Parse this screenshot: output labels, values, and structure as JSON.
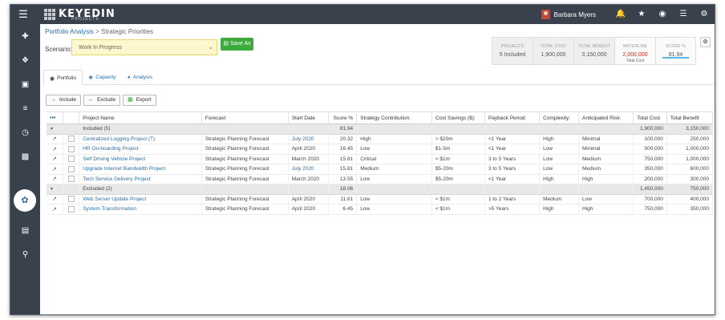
{
  "app": {
    "logo_text": "KEYEDIN",
    "logo_sub": "PROJECTS",
    "user_name": "Barbara Myers"
  },
  "topbar_icons": [
    "menu-icon",
    "bell-icon",
    "star-icon",
    "globe-icon",
    "list-icon",
    "gear-icon"
  ],
  "sidebar_icons": [
    "plus-icon",
    "pin-icon",
    "briefcase-icon",
    "sliders-icon",
    "clock-icon",
    "money-icon",
    "portfolio-icon",
    "dashboard-icon",
    "bar-chart-icon",
    "search-icon"
  ],
  "breadcrumb": {
    "parent": "Portfolio Analysis",
    "separator": " > ",
    "current": "Strategic Priorities"
  },
  "scenario": {
    "label": "Scenario:",
    "value": "Work In Progress",
    "save_label": "Save As"
  },
  "stats": {
    "projects": {
      "title": "PROJECTS",
      "value": "5 Included"
    },
    "total_cost": {
      "title": "TOTAL COST",
      "value": "1,900,000"
    },
    "total_benefit": {
      "title": "TOTAL BENEFIT",
      "value": "3,150,000"
    },
    "waterline": {
      "title": "WATERLINE",
      "value": "2,000,000",
      "sub": "Total Cost",
      "color": "#d0271d"
    },
    "score": {
      "title": "SCORE %",
      "value": "81.94",
      "bar_color": "#5bb5e0"
    }
  },
  "tabs": [
    {
      "label": "Portfolio",
      "icon": "binoculars-icon",
      "active": true
    },
    {
      "label": "Capacity",
      "icon": "pin-icon",
      "active": false
    },
    {
      "label": "Analysis",
      "icon": "dashboard-icon",
      "active": false
    }
  ],
  "actions": {
    "include": "Include",
    "exclude": "Exclude",
    "export": "Export"
  },
  "table": {
    "menu": "•••",
    "headers": [
      "Project Name",
      "Forecast",
      "Start Date",
      "Score %",
      "Strategy Contribution:",
      "Cost Savings ($):",
      "Payback Period:",
      "Complexity:",
      "Anticipated Risk:",
      "Total Cost",
      "Total Benefit"
    ],
    "included": {
      "label": "Included (5)",
      "score": "81.94",
      "total_cost": "1,900,000",
      "total_benefit": "3,150,000",
      "rows": [
        [
          "Centralized Logging Project (T)",
          "Strategic Planning Forecast",
          "July 2020",
          "20.32",
          "High",
          "> $20m",
          "<1 Year",
          "High",
          "Minimal",
          "100,000",
          "250,000"
        ],
        [
          "HR On-boarding Project",
          "Strategic Planning Forecast",
          "April 2020",
          "16.45",
          "Low",
          "$1-5m",
          "<1 Year",
          "Low",
          "Minimal",
          "500,000",
          "1,000,000"
        ],
        [
          "Self Driving Vehicle Project",
          "Strategic Planning Forecast",
          "March 2020",
          "15.81",
          "Critical",
          "< $1m",
          "3 to 5 Years",
          "Low",
          "Medium",
          "750,000",
          "1,000,000"
        ],
        [
          "Upgrade Internet Bandwidth Project",
          "Strategic Planning Forecast",
          "July 2020",
          "15.81",
          "Medium",
          "$5-20m",
          "3 to 5 Years",
          "Low",
          "Medium",
          "350,000",
          "600,000"
        ],
        [
          "Tech Service Delivery Project",
          "Strategic Planning Forecast",
          "March 2020",
          "13.55",
          "Low",
          "$5-20m",
          "<1 Year",
          "High",
          "High",
          "200,000",
          "300,000"
        ]
      ]
    },
    "excluded": {
      "label": "Excluded (2)",
      "score": "18.06",
      "total_cost": "1,450,000",
      "total_benefit": "750,000",
      "rows": [
        [
          "Web Server Update Project",
          "Strategic Planning Forecast",
          "April 2020",
          "11.61",
          "Low",
          "< $1m",
          "1 to 2 Years",
          "Medium",
          "Low",
          "700,000",
          "400,000"
        ],
        [
          "System Transformation",
          "Strategic Planning Forecast",
          "April 2020",
          "6.45",
          "Low",
          "< $1m",
          ">5 Years",
          "High",
          "High",
          "750,000",
          "350,000"
        ]
      ]
    }
  }
}
